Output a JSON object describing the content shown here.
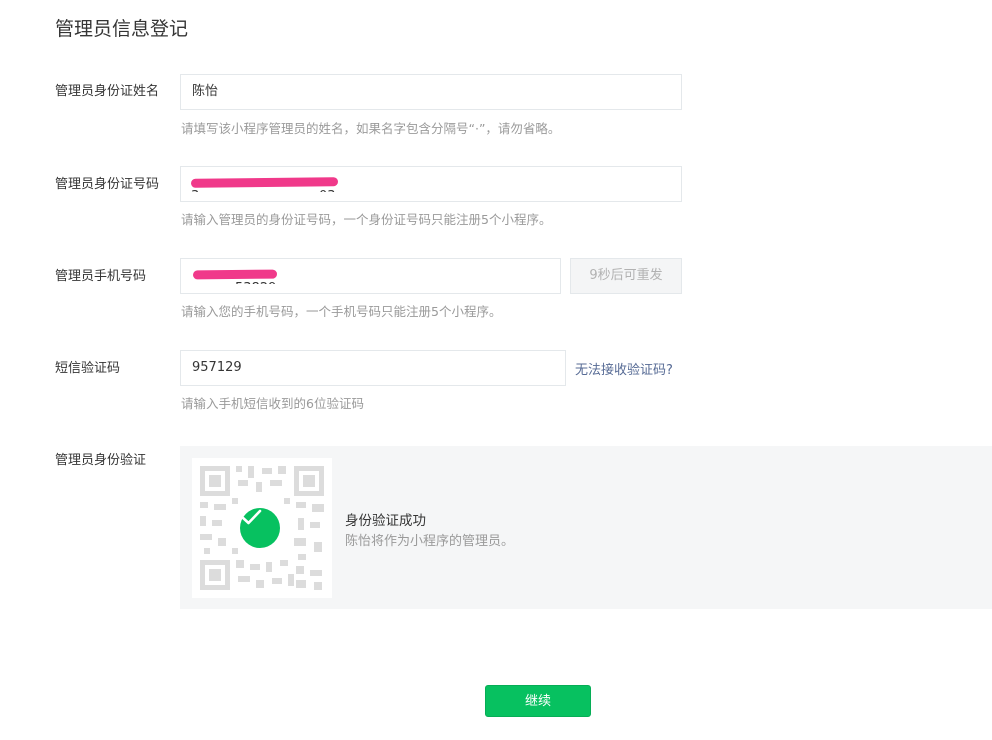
{
  "page": {
    "title": "管理员信息登记"
  },
  "form": {
    "name": {
      "label": "管理员身份证姓名",
      "value": "陈怡",
      "hint": "请填写该小程序管理员的姓名，如果名字包含分隔号“·”，请勿省略。"
    },
    "id_number": {
      "label": "管理员身份证号码",
      "visible_fragments": [
        "3",
        "03"
      ],
      "hint": "请输入管理员的身份证号码，一个身份证号码只能注册5个小程序。"
    },
    "phone": {
      "label": "管理员手机号码",
      "visible_fragments": [
        "53829"
      ],
      "resend_label": "9秒后可重发",
      "hint": "请输入您的手机号码，一个手机号码只能注册5个小程序。"
    },
    "sms_code": {
      "label": "短信验证码",
      "value": "957129",
      "help_link": "无法接收验证码?",
      "hint": "请输入手机短信收到的6位验证码"
    },
    "identity_verify": {
      "label": "管理员身份验证",
      "status_title": "身份验证成功",
      "status_desc": "陈怡将作为小程序的管理员。"
    }
  },
  "actions": {
    "continue_label": "继续"
  },
  "colors": {
    "primary_green": "#07c160",
    "link_blue": "#576b95",
    "redaction_pink": "#f0398a",
    "hint_gray": "#9a9a9a"
  }
}
